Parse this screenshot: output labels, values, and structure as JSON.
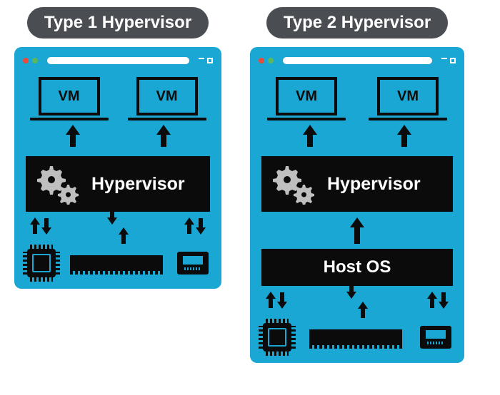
{
  "panels": [
    {
      "title": "Type 1 Hypervisor",
      "vm_label": "VM",
      "hypervisor_label": "Hypervisor",
      "has_host_os": false
    },
    {
      "title": "Type 2 Hypervisor",
      "vm_label": "VM",
      "hypervisor_label": "Hypervisor",
      "host_os_label": "Host OS",
      "has_host_os": true
    }
  ],
  "icons": {
    "cpu": "cpu-chip",
    "ram": "memory-stick",
    "nic": "ethernet-port",
    "gears": "gears"
  },
  "colors": {
    "panel_bg": "#1aa7d3",
    "box_bg": "#0b0b0b",
    "badge_bg": "#4a4e53",
    "text_light": "#ffffff",
    "gear_fill": "#bfbfbf"
  }
}
